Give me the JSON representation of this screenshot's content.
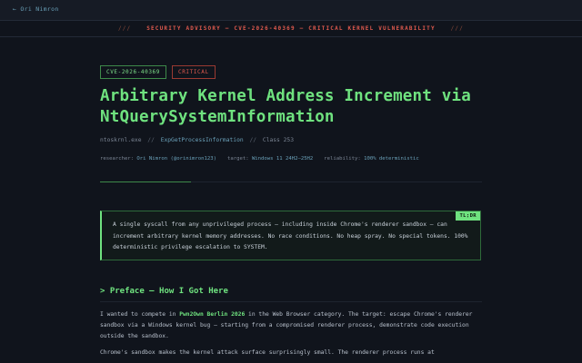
{
  "nav": {
    "back_label": "← Ori Nimron"
  },
  "advisory": {
    "left": "///",
    "text": "SECURITY ADVISORY — CVE-2026-40369 — CRITICAL KERNEL VULNERABILITY",
    "right": "///"
  },
  "badges": {
    "cve": "CVE-2026-40369",
    "severity": "CRITICAL"
  },
  "colors": {
    "accent": "#6fe27f",
    "critical": "#e05a4e",
    "link": "#6aa0b8",
    "background": "#10141c"
  },
  "title": "Arbitrary Kernel Address Increment via NtQuerySystemInformation",
  "path": {
    "module": "ntoskrnl.exe",
    "sep": "//",
    "function": "ExpGetProcessInformation",
    "class": "Class 253"
  },
  "meta": {
    "researcher_label": "researcher:",
    "researcher_value": "Ori Nimron (@orinimron123)",
    "target_label": "target:",
    "target_value": "Windows 11 24H2–25H2",
    "reliability_label": "reliability:",
    "reliability_value": "100% deterministic"
  },
  "tldr": {
    "tag": "TL;DR",
    "text": "A single syscall from any unprivileged process — including inside Chrome's renderer sandbox — can increment arbitrary kernel memory addresses. No race conditions. No heap spray. No special tokens. 100% deterministic privilege escalation to SYSTEM."
  },
  "preface": {
    "heading": "> Preface — How I Got Here",
    "p1_a": "I wanted to compete in ",
    "p1_hl": "Pwn2Own Berlin 2026",
    "p1_b": " in the Web Browser category. The target: escape Chrome's renderer sandbox via a Windows kernel bug — starting from a compromised renderer process, demonstrate code execution outside the sandbox.",
    "p2": "Chrome's sandbox makes the kernel attack surface surprisingly small. The renderer process runs at"
  }
}
